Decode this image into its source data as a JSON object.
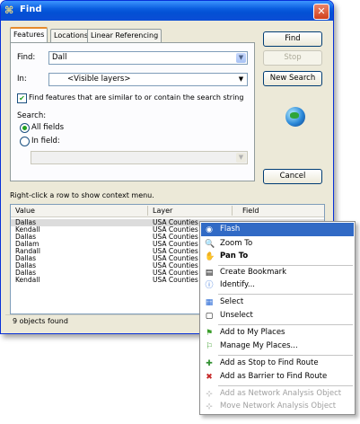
{
  "window": {
    "title": "Find",
    "close_glyph": "✕"
  },
  "tabs": [
    {
      "label": "Features",
      "active": true
    },
    {
      "label": "Locations",
      "active": false
    },
    {
      "label": "Linear Referencing",
      "active": false
    }
  ],
  "form": {
    "find_label": "Find:",
    "find_value": "Dall",
    "in_label": "In:",
    "in_value": "<Visible layers>",
    "similar_checkbox_label": "Find features that are similar to or contain the search string",
    "similar_checked": true,
    "search_label": "Search:",
    "all_fields_label": "All fields",
    "in_field_label": "In field:",
    "in_field_value": ""
  },
  "buttons": {
    "find": "Find",
    "stop": "Stop",
    "new_search": "New Search",
    "cancel": "Cancel"
  },
  "hint": "Right-click a row to show context menu.",
  "results": {
    "columns": [
      "Value",
      "Layer",
      "Field"
    ],
    "rows": [
      [
        "Dallas",
        "USA Counties"
      ],
      [
        "Kendall",
        "USA Counties"
      ],
      [
        "Dallas",
        "USA Counties"
      ],
      [
        "Dallam",
        "USA Counties"
      ],
      [
        "Randall",
        "USA Counties"
      ],
      [
        "Dallas",
        "USA Counties"
      ],
      [
        "Dallas",
        "USA Counties"
      ],
      [
        "Dallas",
        "USA Counties"
      ],
      [
        "Kendall",
        "USA Counties"
      ]
    ],
    "status": "9 objects found"
  },
  "context_menu": {
    "items": [
      {
        "label": "Flash",
        "icon": "flash-icon",
        "glyph": "◉"
      },
      {
        "label": "Zoom To",
        "icon": "zoom-icon",
        "glyph": "🔍"
      },
      {
        "label": "Pan To",
        "icon": "pan-hand-icon",
        "glyph": "✋"
      },
      {
        "label": "Create Bookmark",
        "icon": "bookmark-icon",
        "glyph": "▤"
      },
      {
        "label": "Identify...",
        "icon": "identify-icon",
        "glyph": "ⓘ"
      },
      {
        "label": "Select",
        "icon": "select-icon",
        "glyph": "▦"
      },
      {
        "label": "Unselect",
        "icon": "unselect-icon",
        "glyph": "▢"
      },
      {
        "label": "Add to My Places",
        "icon": "add-place-icon",
        "glyph": "⚑"
      },
      {
        "label": "Manage My Places...",
        "icon": "manage-places-icon",
        "glyph": "⚐"
      },
      {
        "label": "Add as Stop to Find Route",
        "icon": "route-stop-icon",
        "glyph": "✚"
      },
      {
        "label": "Add as Barrier to Find Route",
        "icon": "route-barrier-icon",
        "glyph": "✖"
      },
      {
        "label": "Add as Network Analysis Object",
        "icon": "network-add-icon",
        "glyph": "⊹"
      },
      {
        "label": "Move Network Analysis Object",
        "icon": "network-move-icon",
        "glyph": "⊹"
      }
    ]
  },
  "colors": {
    "highlight": "#316ac5",
    "title_bar": "#0a5ddf",
    "check_green": "#21a121"
  }
}
